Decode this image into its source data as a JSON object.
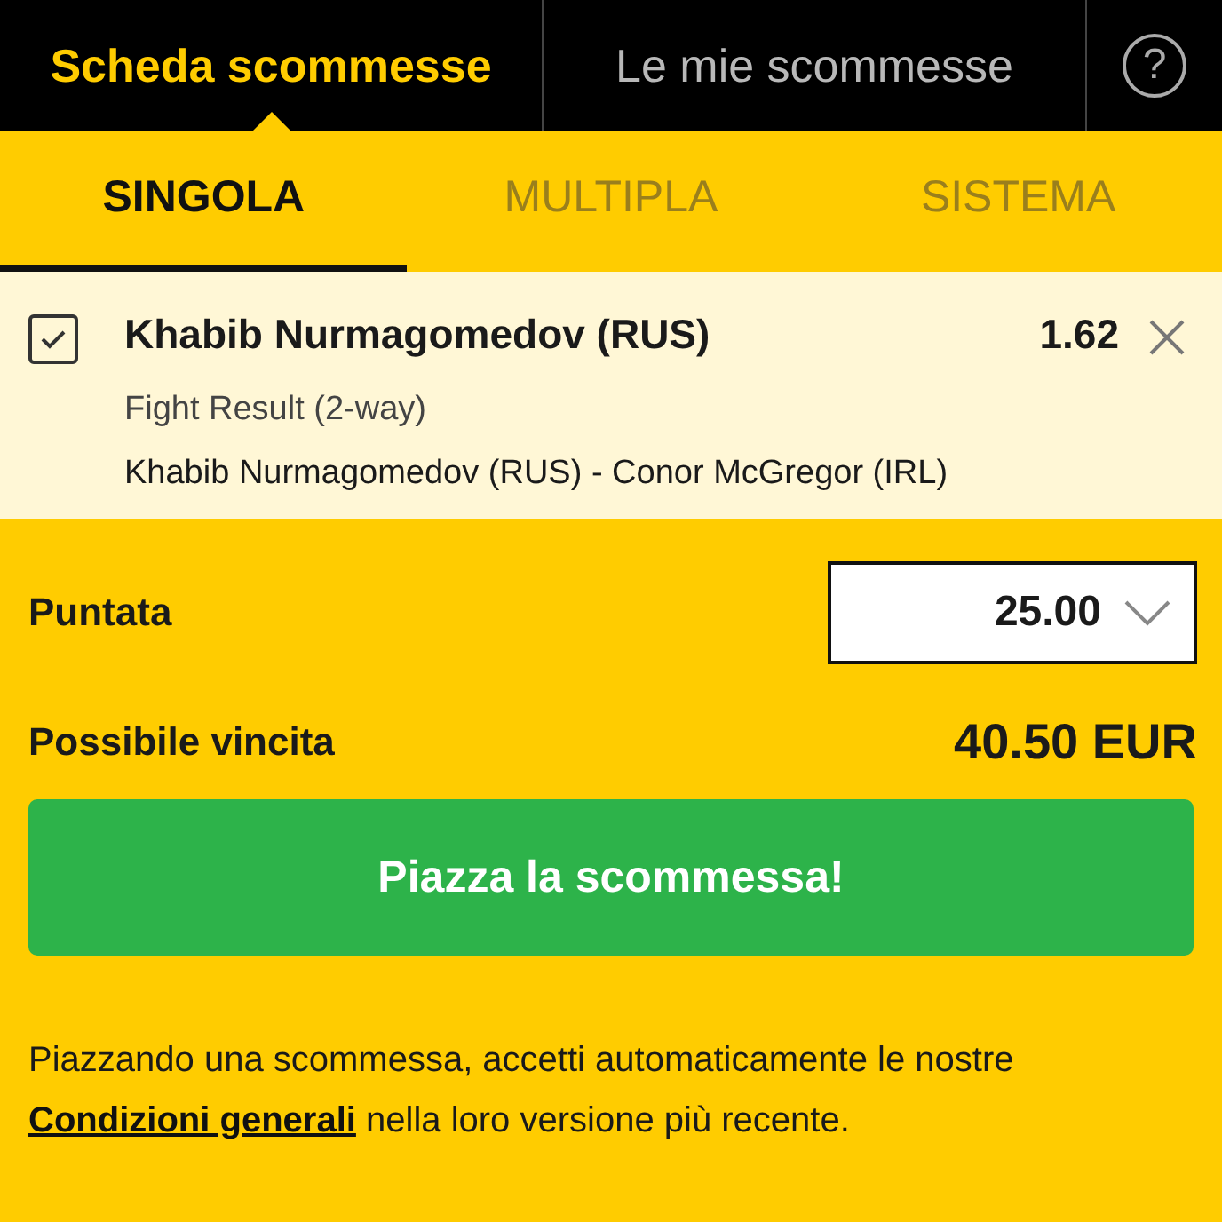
{
  "top_tabs": [
    {
      "label": "Scheda scommesse",
      "selected": true
    },
    {
      "label": "Le mie scommesse",
      "selected": false
    }
  ],
  "help_button": {
    "label": "?"
  },
  "bet_types": [
    {
      "label": "SINGOLA",
      "selected": true
    },
    {
      "label": "MULTIPLA",
      "selected": false
    },
    {
      "label": "SISTEMA",
      "selected": false
    }
  ],
  "selection": {
    "checked": true,
    "name": "Khabib Nurmagomedov (RUS)",
    "odds": "1.62",
    "market": "Fight Result (2-way)",
    "event": "Khabib Nurmagomedov (RUS) - Conor McGregor (IRL)"
  },
  "stake": {
    "label": "Puntata",
    "value": "25.00"
  },
  "winnings": {
    "label": "Possibile vincita",
    "value": "40.50 EUR"
  },
  "place_button": {
    "label": "Piazza la scommessa!"
  },
  "terms": {
    "before": "Piazzando una scommessa, accetti automaticamente le nostre",
    "link": "Condizioni generali",
    "after": "nella loro versione più recente."
  }
}
